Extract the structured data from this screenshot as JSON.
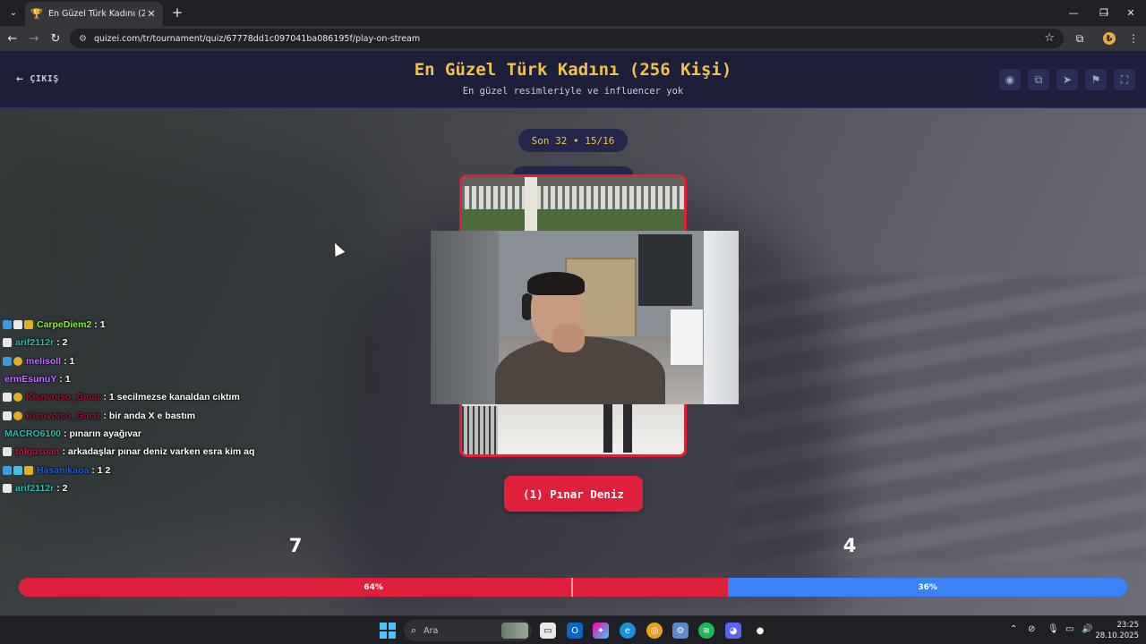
{
  "browser": {
    "tab_title": "En Güzel Türk Kadını (256 Kişi)",
    "url": "quizei.com/tr/tournament/quiz/67778dd1c097041ba086195f/play-on-stream"
  },
  "header": {
    "exit_label": "ÇIKIŞ",
    "title": "En Güzel Türk Kadını (256 Kişi)",
    "subtitle": "En güzel resimleriyle ve influencer yok"
  },
  "round": {
    "label": "Son 32 • 15/16"
  },
  "choice": {
    "button_label": "(1) Pınar Deniz"
  },
  "votes": {
    "left_count": "7",
    "right_count": "4",
    "left_percent_label": "64%",
    "right_percent_label": "36%",
    "left_fraction": 0.64,
    "left_color": "#e0203a",
    "right_color": "#3b82f6"
  },
  "chat": [
    {
      "badges": [
        "b-blue",
        "b-white",
        "b-gold"
      ],
      "user": "CarpeDiem2",
      "color": "#7cfc00",
      "message": ": 1"
    },
    {
      "badges": [
        "b-white"
      ],
      "user": "arif2112r",
      "color": "#20c0b0",
      "message": ": 2"
    },
    {
      "badges": [
        "b-blue",
        "b-coin"
      ],
      "user": "melisoll",
      "color": "#c070ff",
      "message": ": 1"
    },
    {
      "badges": [],
      "user": "ermEsunuY",
      "color": "#c070ff",
      "message": ": 1"
    },
    {
      "badges": [
        "b-white",
        "b-coin"
      ],
      "user": "Kisnvoiso_Gmar",
      "color": "#a01030",
      "message": ": 1 secilmezse kanaldan cıktım"
    },
    {
      "badges": [
        "b-white",
        "b-coin"
      ],
      "user": "Kisnvoiso_Gmar",
      "color": "#a01030",
      "message": ": bir anda X e bastım"
    },
    {
      "badges": [],
      "user": "MACRO6100",
      "color": "#20c0b0",
      "message": ": pınarın ayağıvar"
    },
    {
      "badges": [
        "b-white"
      ],
      "user": "tolgasoan",
      "color": "#d01040",
      "message": ": arkadaşlar pınar deniz varken esra kim aq"
    },
    {
      "badges": [
        "b-blue",
        "b-cyan",
        "b-gold"
      ],
      "user": "Hasanikaoa",
      "color": "#1a5fd0",
      "message": ": 1 2"
    },
    {
      "badges": [
        "b-white"
      ],
      "user": "arif2112r",
      "color": "#20c0b0",
      "message": ": 2"
    }
  ],
  "taskbar": {
    "search_placeholder": "Ara",
    "time": "23:25",
    "date": "28.10.2025"
  },
  "colors": {
    "accent_gold": "#f3c14a",
    "accent_red": "#e0203a",
    "header_bg": "#1c1e3a"
  }
}
